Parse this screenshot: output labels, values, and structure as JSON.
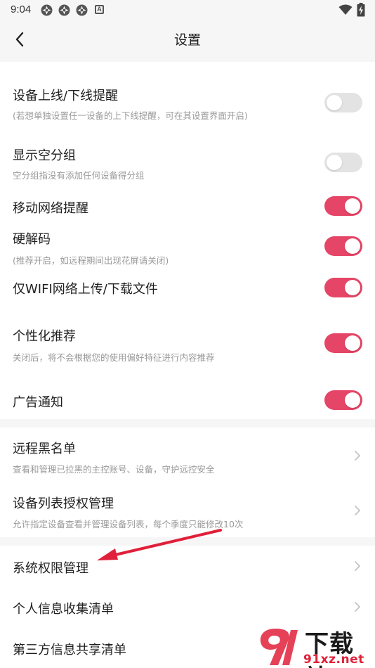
{
  "status_bar": {
    "time": "9:04",
    "notif_letter": "A",
    "icons": [
      "notification-icon",
      "notification-icon",
      "notification-icon",
      "a-icon",
      "wifi-icon",
      "battery-charging-icon"
    ]
  },
  "header": {
    "title": "设置",
    "back_icon": "back-arrow-icon"
  },
  "toggles": [
    {
      "title": "设备上线/下线提醒",
      "subtitle": "(若想单独设置任一设备的上下线提醒，可在其设置界面开启)",
      "on": false
    },
    {
      "title": "显示空分组",
      "subtitle": "空分组指没有添加任何设备得分组",
      "on": false
    },
    {
      "title": "移动网络提醒",
      "subtitle": "",
      "on": true
    },
    {
      "title": "硬解码",
      "subtitle": "(推荐开启，如远程期间出现花屏请关闭)",
      "on": true
    },
    {
      "title": "仅WIFI网络上传/下载文件",
      "subtitle": "",
      "on": true
    },
    {
      "title": "个性化推荐",
      "subtitle": "关闭后，将不会根据您的使用偏好特征进行内容推荐",
      "on": true
    },
    {
      "title": "广告通知",
      "subtitle": "",
      "on": true
    }
  ],
  "management": [
    {
      "title": "远程黑名单",
      "subtitle": "查看和管理已拉黑的主控账号、设备，守护远控安全"
    },
    {
      "title": "设备列表授权管理",
      "subtitle": "允许指定设备查看并管理设备列表，每个季度只能修改10次"
    }
  ],
  "privacy": [
    {
      "title": "系统权限管理"
    },
    {
      "title": "个人信息收集清单"
    },
    {
      "title": "第三方信息共享清单"
    }
  ],
  "colors": {
    "accent": "#e54566",
    "toggle_off": "#e3e3e3",
    "background": "#f6f6f6",
    "annotation": "#e0203a"
  },
  "watermark": {
    "main": "下载站",
    "url": "91xz.net"
  }
}
